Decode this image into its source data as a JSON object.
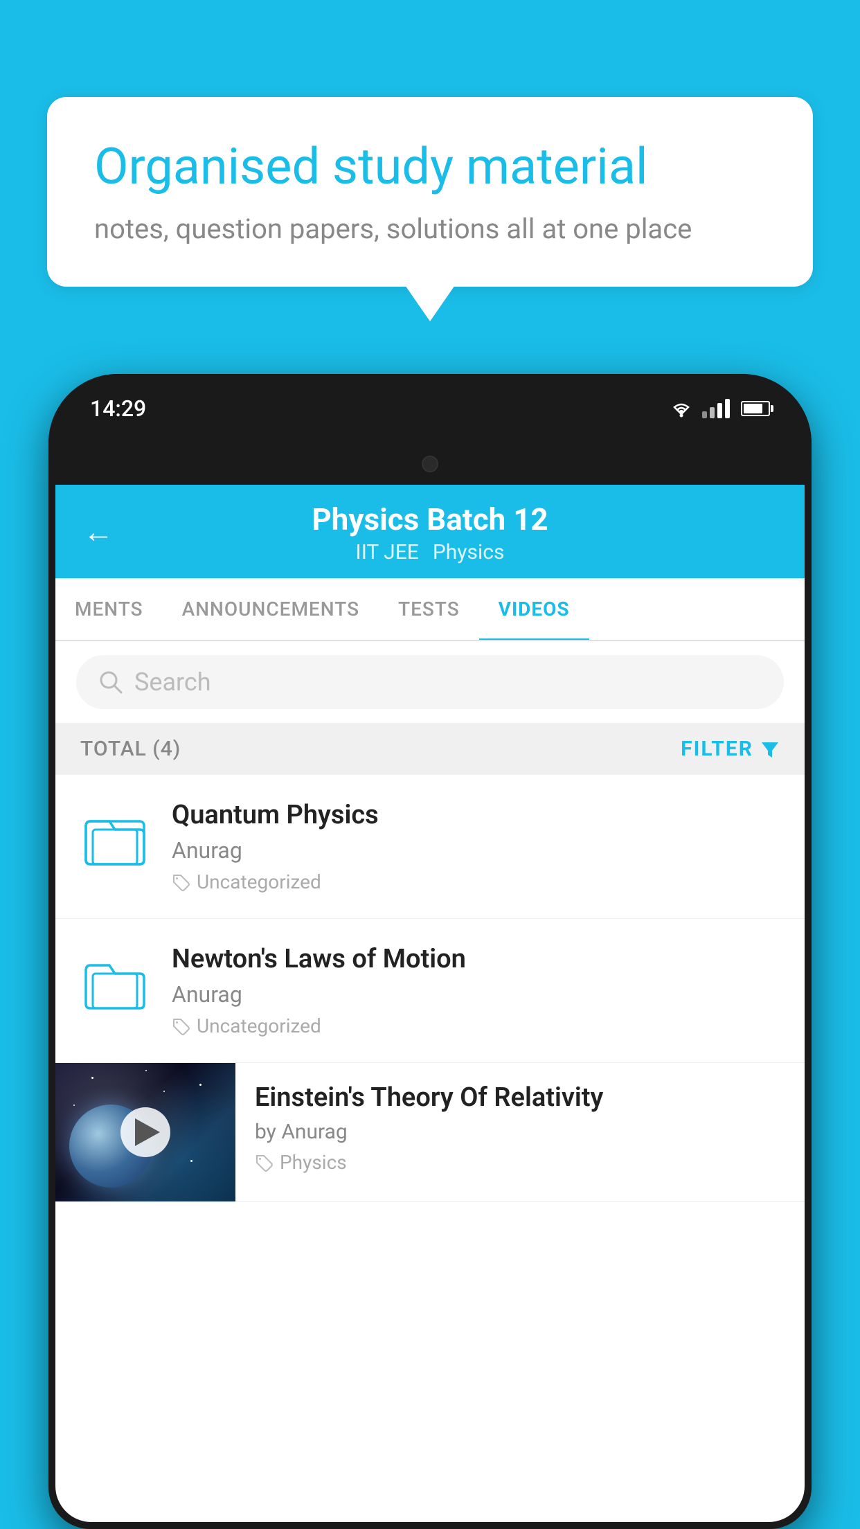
{
  "background_color": "#1abde8",
  "speech_bubble": {
    "title": "Organised study material",
    "subtitle": "notes, question papers, solutions all at one place"
  },
  "phone": {
    "status_bar": {
      "time": "14:29"
    },
    "app": {
      "header": {
        "back_label": "←",
        "title": "Physics Batch 12",
        "subtitle_1": "IIT JEE",
        "subtitle_2": "Physics"
      },
      "tabs": [
        {
          "label": "MENTS",
          "active": false
        },
        {
          "label": "ANNOUNCEMENTS",
          "active": false
        },
        {
          "label": "TESTS",
          "active": false
        },
        {
          "label": "VIDEOS",
          "active": true
        }
      ],
      "search": {
        "placeholder": "Search"
      },
      "filter_bar": {
        "total_label": "TOTAL (4)",
        "filter_label": "FILTER"
      },
      "videos": [
        {
          "id": 1,
          "title": "Quantum Physics",
          "author": "Anurag",
          "tag": "Uncategorized",
          "has_thumbnail": false
        },
        {
          "id": 2,
          "title": "Newton's Laws of Motion",
          "author": "Anurag",
          "tag": "Uncategorized",
          "has_thumbnail": false
        },
        {
          "id": 3,
          "title": "Einstein's Theory Of Relativity",
          "author": "by Anurag",
          "tag": "Physics",
          "has_thumbnail": true
        }
      ]
    }
  }
}
